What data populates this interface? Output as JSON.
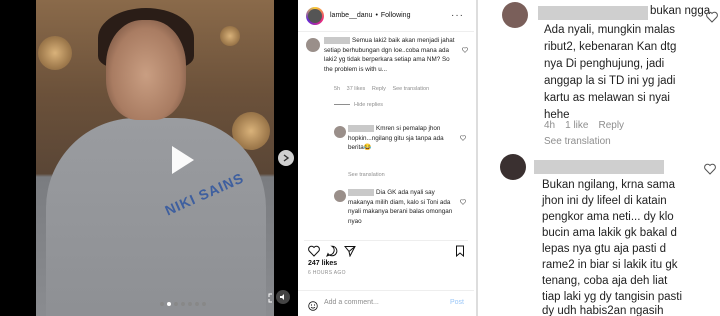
{
  "post": {
    "username": "lambe__danu",
    "follow_state": "Following",
    "brand_text": "NIKI SAINS",
    "likes": "247 likes",
    "posted_ago": "6 HOURS AGO",
    "add_comment_placeholder": "Add a comment...",
    "post_label": "Post"
  },
  "comments": [
    {
      "text": "Semua laki2 baik akan menjadi jahat setiap berhubungan dgn loe..coba mana ada laki2 yg tidak berperkara setiap ama NM? So the problem is with u...",
      "age": "5h",
      "likes": "37 likes",
      "reply": "Reply",
      "translate": "See translation",
      "hide_replies": "Hide replies"
    },
    {
      "text": "Kmren si pemalap jhon hopkin...ngilang gitu sja tanpa ada berita😂",
      "translate": "See translation"
    },
    {
      "text": "Dia GK ada nyali say makanya milih diam, kalo si Toni ada nyali makanya berani balas omongan nyao"
    }
  ],
  "zoom": {
    "first": {
      "lead": "bukan ngga",
      "text_lines": [
        "Ada nyali, mungkin malas",
        "ribut2, kebenaran Kan dtg",
        "nya Di penghujung, jadi",
        "anggap la si TD ini yg jadi",
        "kartu as melawan si nyai",
        "hehe"
      ],
      "age": "4h",
      "likes": "1 like",
      "reply": "Reply",
      "translate": "See translation"
    },
    "second": {
      "text_lines": [
        "Bukan ngilang, krna sama",
        "jhon ini dy lifeel di katain",
        "pengkor ama neti... dy klo",
        "bucin ama lakik gk bakal d",
        "lepas nya gtu aja pasti d",
        "rame2 in biar si lakik itu gk",
        "tenang, coba aja deh liat",
        "tiap laki yg dy tangisin pasti",
        "dy udh habis2an ngasih"
      ]
    }
  },
  "colors": {
    "link": "#9ac7f8",
    "muted": "#8e8e8e",
    "brand_blue": "#3e5f9f"
  }
}
